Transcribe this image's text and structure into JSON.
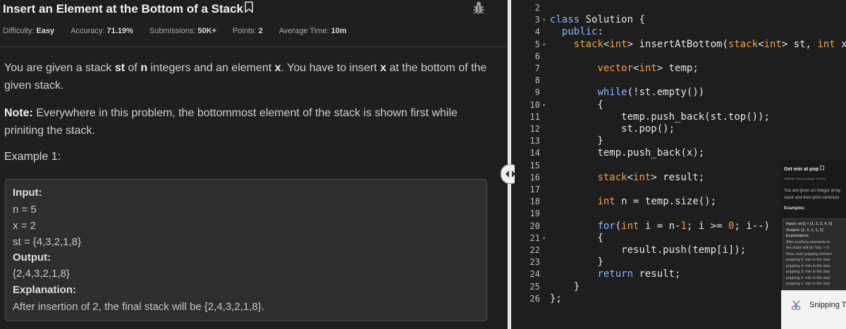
{
  "problem": {
    "title": "Insert an Element at the Bottom of a Stack",
    "meta": [
      {
        "label": "Difficulty:",
        "value": "Easy"
      },
      {
        "label": "Accuracy:",
        "value": "71.19%"
      },
      {
        "label": "Submissions:",
        "value": "50K+"
      },
      {
        "label": "Points:",
        "value": "2"
      },
      {
        "label": "Average Time:",
        "value": "10m"
      }
    ],
    "para1_parts": [
      "You are given a stack ",
      "st",
      " of ",
      "n",
      " integers and an element ",
      "x",
      ". You have to insert ",
      "x",
      " at the bottom of the given stack."
    ],
    "note_label": "Note:",
    "note_text": " Everywhere in this problem, the bottommost element of the stack is shown first while priniting the stack.",
    "example_title": "Example 1:",
    "example": {
      "input_label": "Input:",
      "input_lines": [
        "n = 5",
        "x = 2",
        "st = {4,3,2,1,8}"
      ],
      "output_label": "Output:",
      "output_value": "{2,4,3,2,1,8}",
      "explanation_label": "Explanation:",
      "explanation_text": "After insertion of 2, the final stack will be {2,4,3,2,1,8}."
    }
  },
  "editor": {
    "line_numbers": [
      "2",
      "3",
      "4",
      "5",
      "6",
      "7",
      "8",
      "9",
      "10",
      "11",
      "12",
      "13",
      "14",
      "15",
      "16",
      "17",
      "18",
      "19",
      "20",
      "21",
      "22",
      "23",
      "24",
      "25",
      "26"
    ],
    "lines": [
      "",
      "class Solution {",
      "  public:",
      "    stack<int> insertAtBottom(stack<int> st, int x) {",
      "",
      "        vector<int> temp;",
      "",
      "        while(!st.empty())",
      "        {",
      "            temp.push_back(st.top());",
      "            st.pop();",
      "        }",
      "        temp.push_back(x);",
      "",
      "        stack<int> result;",
      "",
      "        int n = temp.size();",
      "",
      "        for(int i = n-1; i >= 0; i--)",
      "        {",
      "            result.push(temp[i]);",
      "        }",
      "        return result;",
      "    }",
      "};"
    ]
  },
  "pip": {
    "title": "Get min at pop",
    "meta": "Difficulty: Easy   Accuracy: 49.04%",
    "line1": "You are given an integer array",
    "line2": "stack and then print minimum",
    "examples": "Examples:",
    "box_lines": [
      "Input: arr[] = [1, 2, 3, 4, 5]",
      "Output: [1, 1, 1, 1, 1]",
      "Explanation:",
      "After pushing elements to",
      "the stack will be \"top -> 5",
      "Now, start popping elemen",
      "popping 5: min in the stac",
      "popping 4: min in the stac",
      "popping 3: min in the stac",
      "popping 2: min in the stac",
      "popping 1: min in the stac"
    ]
  },
  "snipping": {
    "label": "Snipping T"
  },
  "icons": {
    "bookmark": "bookmark-icon",
    "bug": "bug-icon",
    "splitter": "drag-handle-icon",
    "snip": "snipping-tool-icon"
  }
}
